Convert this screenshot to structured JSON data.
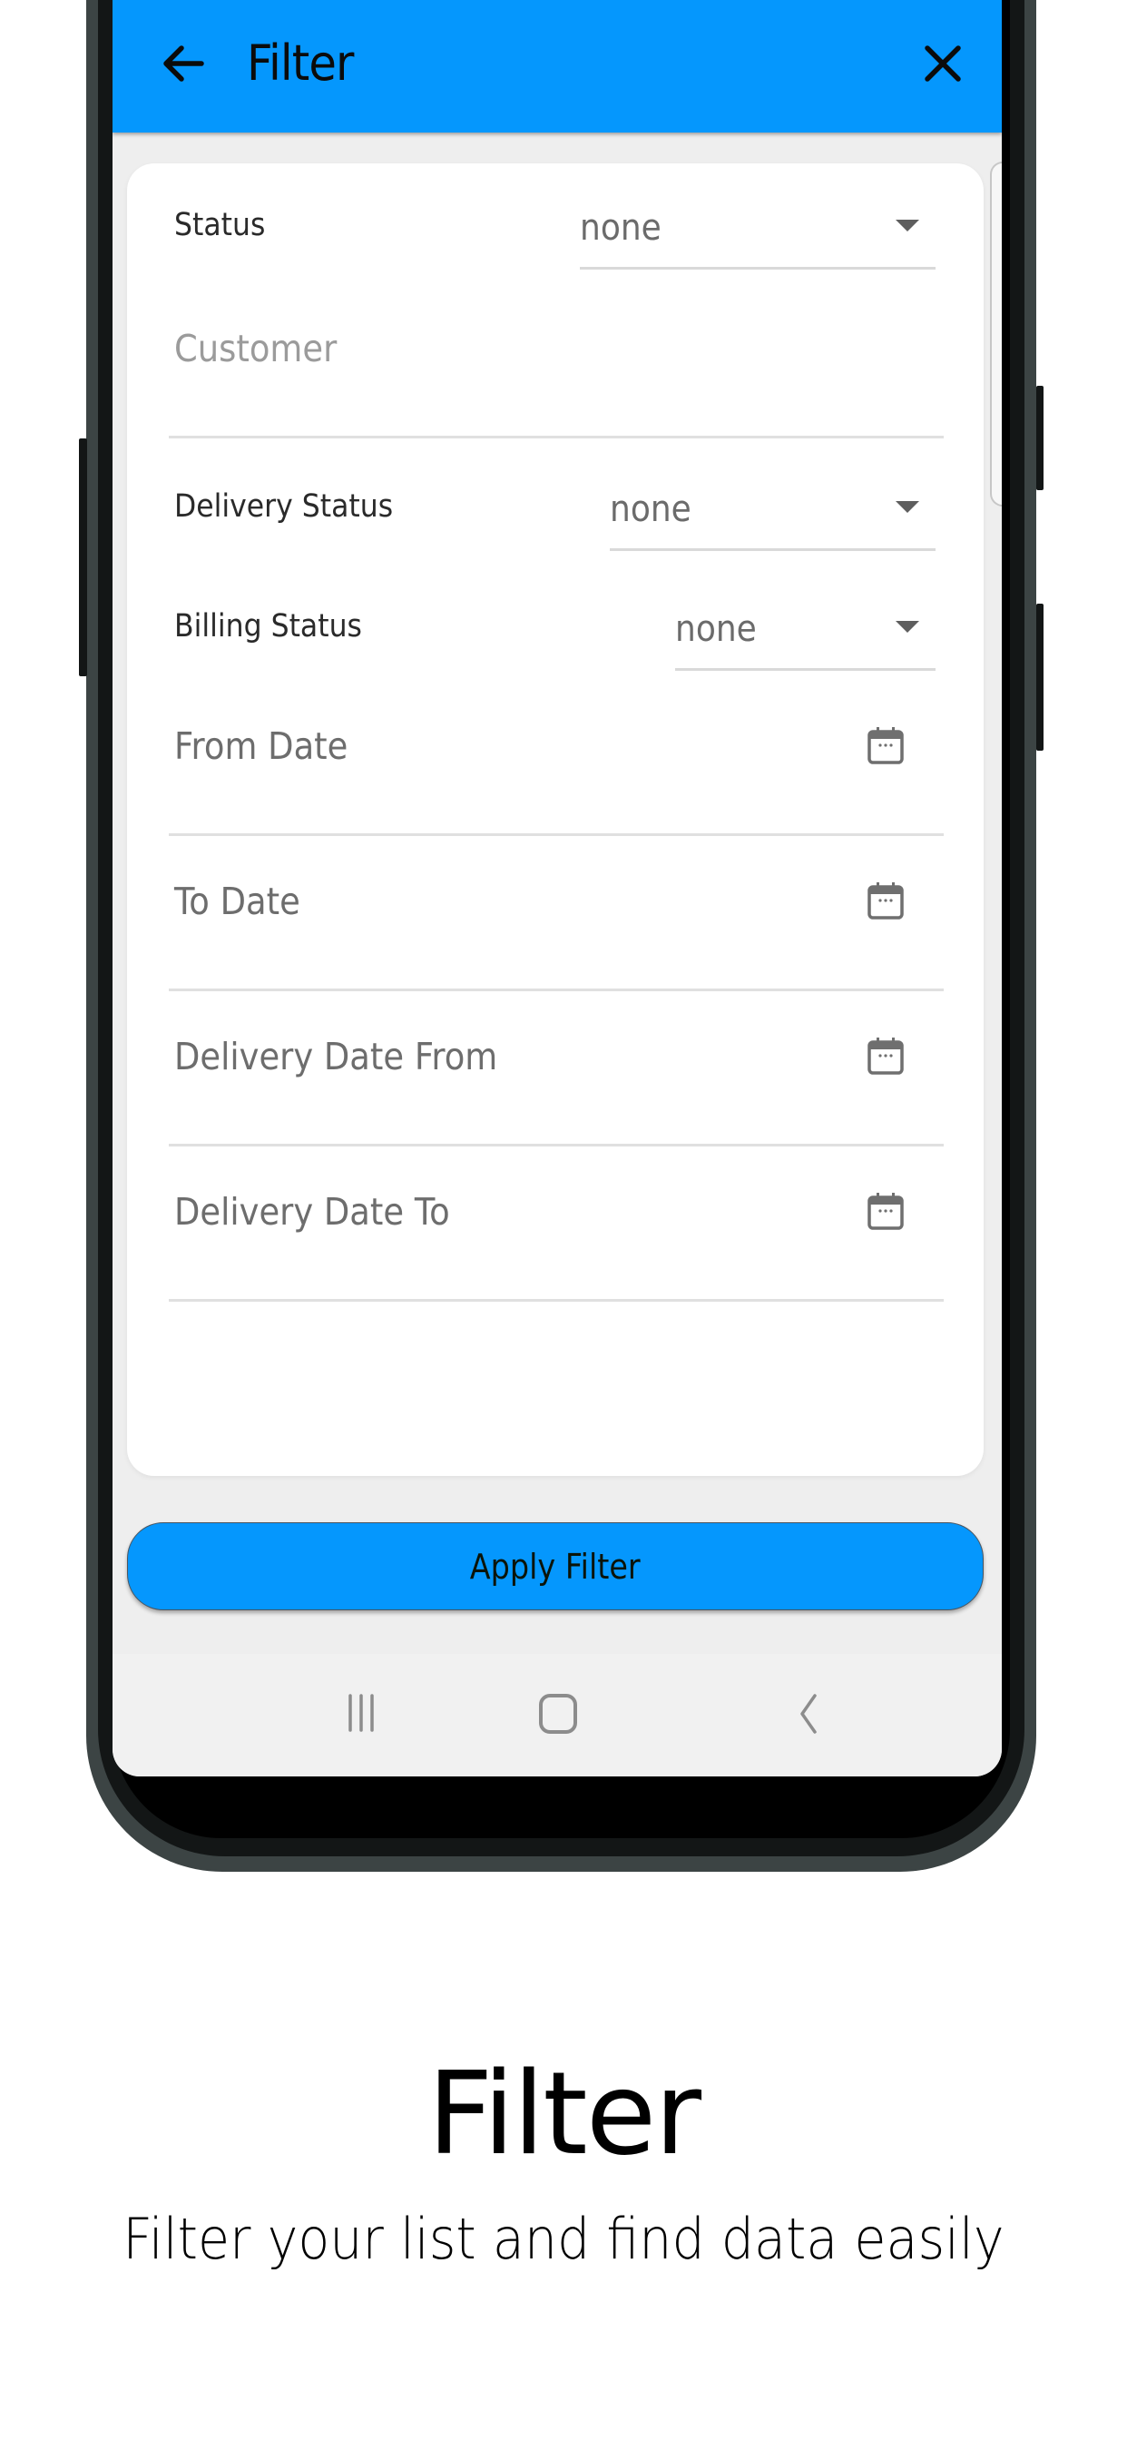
{
  "colors": {
    "primary": "#0597fd",
    "background": "#eeeeee",
    "card": "#ffffff",
    "frame": "#3c4444"
  },
  "appbar": {
    "title": "Filter",
    "back_icon": "arrow-left-icon",
    "close_icon": "close-icon"
  },
  "form": {
    "status": {
      "label": "Status",
      "value": "none"
    },
    "customer": {
      "placeholder": "Customer",
      "value": ""
    },
    "delivery_status": {
      "label": "Delivery Status",
      "value": "none"
    },
    "billing_status": {
      "label": "Billing Status",
      "value": "none"
    },
    "from_date": {
      "placeholder": "From Date",
      "icon": "calendar-icon"
    },
    "to_date": {
      "placeholder": "To Date",
      "icon": "calendar-icon"
    },
    "delivery_date_from": {
      "placeholder": "Delivery Date From",
      "icon": "calendar-icon"
    },
    "delivery_date_to": {
      "placeholder": "Delivery Date To",
      "icon": "calendar-icon"
    }
  },
  "actions": {
    "apply_label": "Apply Filter"
  },
  "system_nav": {
    "recents_icon": "recents-icon",
    "home_icon": "home-icon",
    "back_icon": "back-icon"
  },
  "promo": {
    "headline": "Filter",
    "subline": "Filter your list and find data easily"
  }
}
